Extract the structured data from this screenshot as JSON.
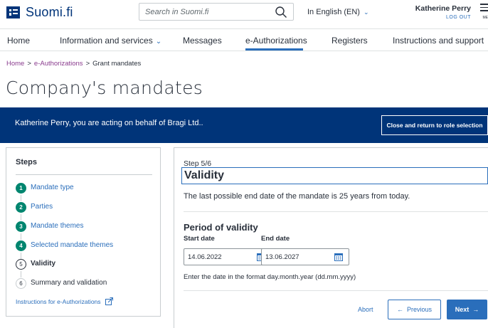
{
  "header": {
    "logo_text": "Suomi.fi",
    "search_placeholder": "Search in Suomi.fi",
    "language": "In English (EN)",
    "user_name": "Katherine Perry",
    "logout_label": "LOG OUT",
    "menu_label": "ME"
  },
  "nav": {
    "items": [
      {
        "label": "Home"
      },
      {
        "label": "Information and services"
      },
      {
        "label": "Messages"
      },
      {
        "label": "e-Authorizations",
        "active": true
      },
      {
        "label": "Registers"
      },
      {
        "label": "Instructions and support"
      }
    ]
  },
  "breadcrumb": {
    "home": "Home",
    "eauth": "e-Authorizations",
    "current": "Grant mandates",
    "separator": ">"
  },
  "page_title": "Company's mandates",
  "banner": {
    "text": "Katherine Perry, you are acting on behalf of Bragi Ltd..",
    "button_label": "Close and return to role selection"
  },
  "steps": {
    "title": "Steps",
    "items": [
      {
        "number": "1",
        "label": "Mandate type",
        "state": "done"
      },
      {
        "number": "2",
        "label": "Parties",
        "state": "done"
      },
      {
        "number": "3",
        "label": "Mandate themes",
        "state": "done"
      },
      {
        "number": "4",
        "label": "Selected mandate themes",
        "state": "done"
      },
      {
        "number": "5",
        "label": "Validity",
        "state": "current"
      },
      {
        "number": "6",
        "label": "Summary and validation",
        "state": "future"
      }
    ],
    "instructions_link": "Instructions for e-Authorizations"
  },
  "main": {
    "step_count": "Step 5/6",
    "title": "Validity",
    "intro": "The last possible end date of the mandate is 25 years from today.",
    "period_title": "Period of validity",
    "start_label": "Start date",
    "start_value": "14.06.2022",
    "end_label": "End date",
    "end_value": "13.06.2027",
    "hint": "Enter the date in the format day.month.year (dd.mm.yyyy)",
    "abort_label": "Abort",
    "previous_label": "Previous",
    "next_label": "Next"
  },
  "colors": {
    "brand_blue": "#003479",
    "link_blue": "#2a6ebb",
    "done_green": "#00856f",
    "breadcrumb_purple": "#8a3c8e"
  }
}
